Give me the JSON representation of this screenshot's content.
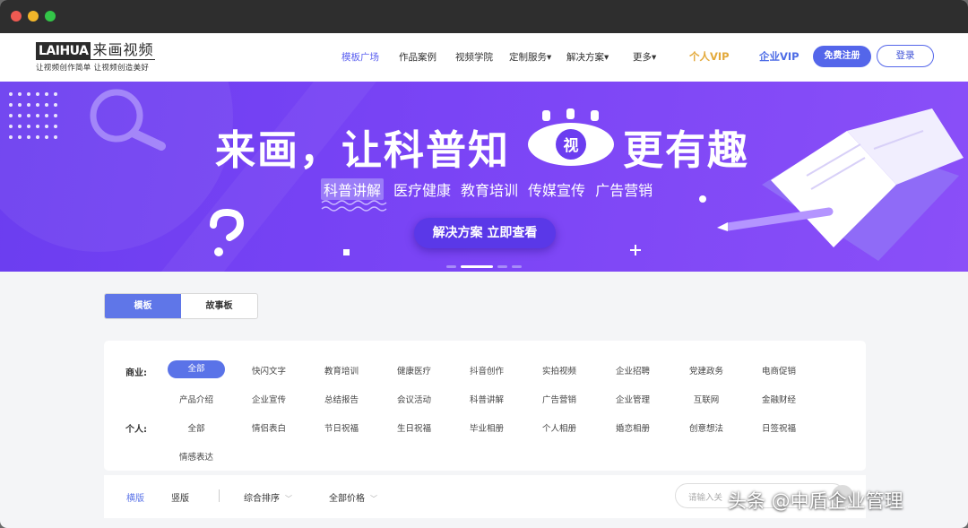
{
  "logo": {
    "brand": "LAIHUA",
    "cn": "来画视频",
    "tagline": "让视频创作简单  让视频创造美好"
  },
  "nav": {
    "items": [
      "模板广场",
      "作品案例",
      "视频学院",
      "定制服务▾",
      "解决方案▾",
      "更多▾"
    ],
    "vip_personal": "个人VIP",
    "vip_corp": "企业VIP",
    "register": "免费注册",
    "login": "登录"
  },
  "banner": {
    "headline_a": "来画，让科普知",
    "eye_char": "视",
    "headline_b": "更有趣",
    "categories": [
      "科普讲解",
      "医疗健康",
      "教育培训",
      "传媒宣传",
      "广告营销"
    ],
    "cta": "解决方案 立即查看"
  },
  "tabs": [
    "模板",
    "故事板"
  ],
  "filters": {
    "business_label": "商业:",
    "business_items": [
      "全部",
      "快闪文字",
      "教育培训",
      "健康医疗",
      "抖音创作",
      "实拍视频",
      "企业招聘",
      "党建政务",
      "电商促销",
      "产品介绍",
      "企业宣传",
      "总结报告",
      "会议活动",
      "科普讲解",
      "广告营销",
      "企业管理",
      "互联网",
      "金融财经"
    ],
    "personal_label": "个人:",
    "personal_items": [
      "全部",
      "情侣表白",
      "节日祝福",
      "生日祝福",
      "毕业相册",
      "个人相册",
      "婚恋相册",
      "创意想法",
      "日签祝福",
      "情感表达"
    ]
  },
  "sortbar": {
    "landscape": "横版",
    "portrait": "竖版",
    "sort": "综合排序",
    "price": "全部价格",
    "search_placeholder": "请输入关"
  },
  "watermark": "头条 @中盾企业管理",
  "colors": {
    "accent": "#5a73e8",
    "banner": "#7a44f5",
    "vip_gold": "#e3a93a"
  }
}
